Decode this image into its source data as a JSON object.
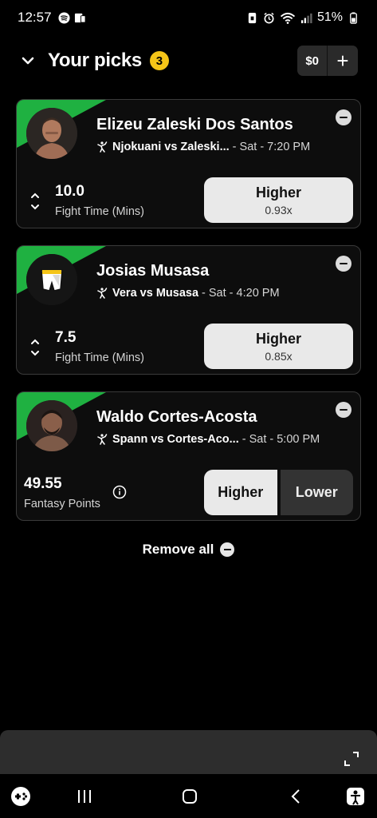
{
  "status": {
    "time": "12:57",
    "battery": "51%"
  },
  "header": {
    "title": "Your picks",
    "count": "3",
    "wallet_amount": "$0",
    "add_label": "+"
  },
  "picks": [
    {
      "player": "Elizeu Zaleski Dos Santos",
      "match": "Njokuani vs Zaleski...",
      "time": "- Sat - 7:20 PM",
      "stat_value": "10.0",
      "stat_label": "Fight Time (Mins)",
      "choice": "Higher",
      "multiplier": "0.93x"
    },
    {
      "player": "Josias Musasa",
      "match": "Vera vs Musasa",
      "time": "- Sat - 4:20 PM",
      "stat_value": "7.5",
      "stat_label": "Fight Time (Mins)",
      "choice": "Higher",
      "multiplier": "0.85x"
    },
    {
      "player": "Waldo Cortes-Acosta",
      "match": "Spann vs Cortes-Aco...",
      "time": "- Sat - 5:00 PM",
      "stat_value": "49.55",
      "stat_label": "Fantasy Points",
      "higher_label": "Higher",
      "lower_label": "Lower"
    }
  ],
  "remove_all_label": "Remove all",
  "colors": {
    "accent_green": "#1fb141",
    "badge_yellow": "#f5c518",
    "button_light": "#e9e9e9",
    "button_dark": "#333333"
  },
  "icons": [
    "chevron-down-icon",
    "plus-icon",
    "minus-circle-icon",
    "fighter-icon",
    "up-down-arrows-icon",
    "info-icon",
    "expand-icon",
    "game-controller-icon",
    "recent-apps-icon",
    "home-icon",
    "back-icon",
    "accessibility-icon"
  ]
}
